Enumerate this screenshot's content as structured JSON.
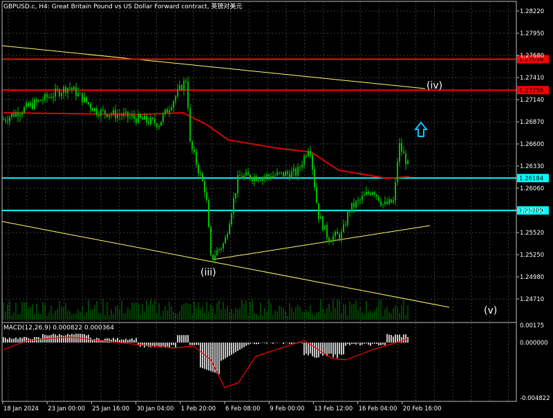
{
  "header": {
    "symbol_label": "GBPUSD.c, H4:  Great Britain Pound vs US Dollar Forward contract, 英镑对美元"
  },
  "macd": {
    "label": "MACD(12,26,9) 0.000822 0.000364",
    "axis_labels": [
      "0.00175",
      "0.000000",
      "-0.004822"
    ]
  },
  "price_axis_labels": [
    "1.28220",
    "1.27950",
    "1.27680",
    "1.27410",
    "1.27140",
    "1.26870",
    "1.26600",
    "1.26330",
    "1.26060",
    "1.25790",
    "1.25520",
    "1.25250",
    "1.24980",
    "1.24710"
  ],
  "levels": [
    {
      "label": "1.27634",
      "value": 1.27634,
      "color": "#ff0000"
    },
    {
      "label": "1.27256",
      "value": 1.27256,
      "color": "#ff0000"
    },
    {
      "label": "1.26184",
      "value": 1.26184,
      "color": "#00ffff"
    },
    {
      "label": "1.25789",
      "value": 1.25789,
      "color": "#00ffff"
    }
  ],
  "time_labels": [
    "18 Jan 2024",
    "23 Jan 00:00",
    "25 Jan 16:00",
    "30 Jan 04:00",
    "1 Feb 20:00",
    "6 Feb 08:00",
    "9 Feb 00:00",
    "13 Feb 12:00",
    "16 Feb 04:00",
    "20 Feb 16:00"
  ],
  "wave_labels": {
    "iii": "(iii)",
    "iv": "(iv)",
    "v": "(v)"
  },
  "colors": {
    "candles": "#00c000",
    "ma": "#e00000",
    "trend": "#ffff66",
    "level_red": "#ff0000",
    "level_cyan": "#00ffff",
    "arrow": "#00ccff",
    "hist": "#c8c8c8",
    "signal": "#ff0000"
  }
}
